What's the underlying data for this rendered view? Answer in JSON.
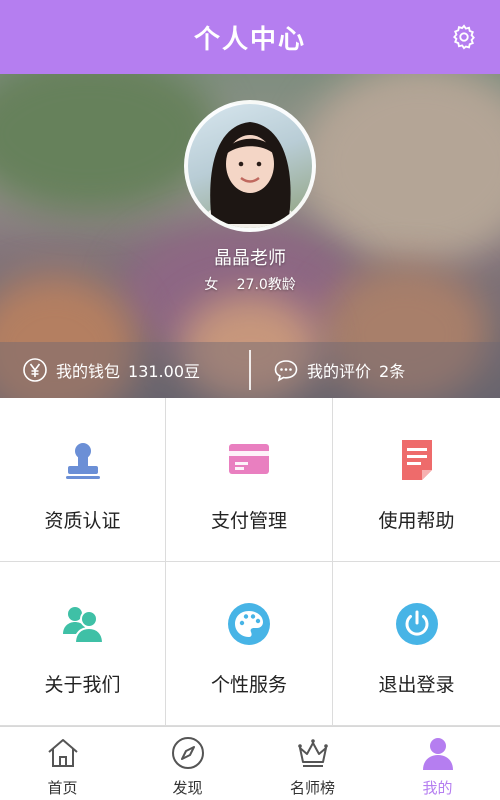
{
  "header": {
    "title": "个人中心",
    "settings_icon": "gear-icon"
  },
  "profile": {
    "name": "晶晶老师",
    "gender": "女",
    "teaching_years": "27.0教龄",
    "avatar_icon": "avatar"
  },
  "stats": {
    "wallet": {
      "label": "我的钱包",
      "value": "131.00豆",
      "icon": "yen-icon"
    },
    "reviews": {
      "label": "我的评价",
      "value": "2条",
      "icon": "chat-icon"
    }
  },
  "menu": [
    {
      "label": "资质认证",
      "icon": "stamp-icon",
      "color": "#6b8fd6"
    },
    {
      "label": "支付管理",
      "icon": "card-icon",
      "color": "#e97fc0"
    },
    {
      "label": "使用帮助",
      "icon": "document-icon",
      "color": "#ee6b6b"
    },
    {
      "label": "关于我们",
      "icon": "users-icon",
      "color": "#3fc0a6"
    },
    {
      "label": "个性服务",
      "icon": "palette-icon",
      "color": "#47b4e6"
    },
    {
      "label": "退出登录",
      "icon": "power-icon",
      "color": "#47b4e6"
    }
  ],
  "tabs": [
    {
      "label": "首页",
      "icon": "home-icon"
    },
    {
      "label": "发现",
      "icon": "compass-icon"
    },
    {
      "label": "名师榜",
      "icon": "crown-icon"
    },
    {
      "label": "我的",
      "icon": "user-icon",
      "active": true
    }
  ],
  "colors": {
    "accent": "#b57ef0",
    "divider": "#dcdcdc"
  }
}
